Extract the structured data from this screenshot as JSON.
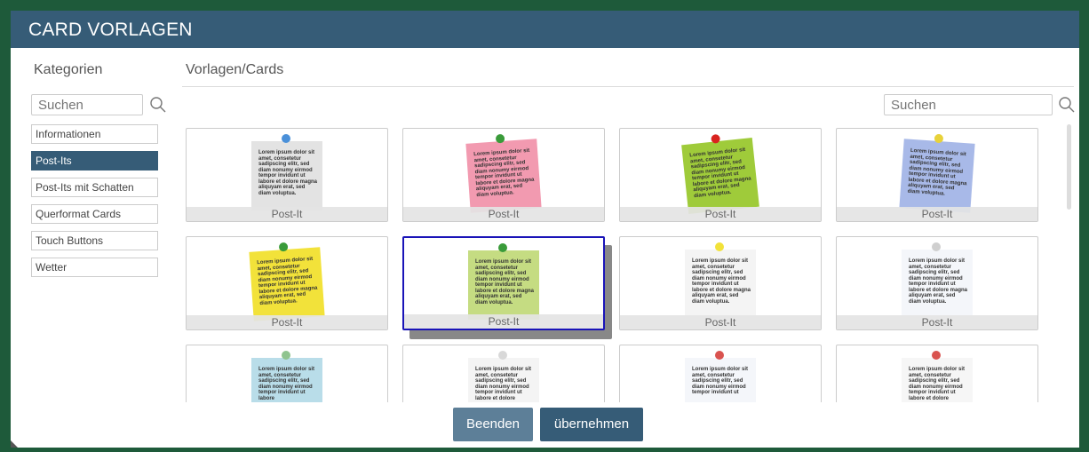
{
  "title": "CARD VORLAGEN",
  "categories": {
    "heading": "Kategorien",
    "search_placeholder": "Suchen",
    "items": [
      "Informationen",
      "Post-Its",
      "Post-Its mit Schatten",
      "Querformat Cards",
      "Touch Buttons",
      "Wetter"
    ],
    "active_index": 1
  },
  "templates": {
    "heading": "Vorlagen/Cards",
    "search_placeholder": "Suchen",
    "cards": [
      {
        "label": "Post-It",
        "color": "#e3e3e3",
        "pin": "#4a90d9",
        "text": "Lorem ipsum dolor sit amet, consetetur sadipscing elitr, sed diam nonumy eirmod tempor invidunt ut labore et dolore magna aliquyam erat, sed diam voluptua."
      },
      {
        "label": "Post-It",
        "color": "#f29ab0",
        "pin": "#3a9b3a",
        "text": "Lorem ipsum dolor sit amet, consetetur sadipscing elitr, sed diam nonumy eirmod tempor invidunt ut labore et dolore magna aliquyam erat, sed diam voluptua."
      },
      {
        "label": "Post-It",
        "color": "#9fcb3a",
        "pin": "#d9231f",
        "text": "Lorem ipsum dolor sit amet, consetetur sadipscing elitr, sed diam nonumy eirmod tempor invidunt ut labore et dolore magna aliquyam erat, sed diam voluptua."
      },
      {
        "label": "Post-It",
        "color": "#a8b9e8",
        "pin": "#e8d23a",
        "text": "Lorem ipsum dolor sit amet, consetetur sadipscing elitr, sed diam nonumy eirmod tempor invidunt ut labore et dolore magna aliquyam erat, sed diam voluptua."
      },
      {
        "label": "Post-It",
        "color": "#f2e23a",
        "pin": "#3a9b3a",
        "text": "Lorem ipsum dolor sit amet, consetetur sadipscing elitr, sed diam nonumy eirmod tempor invidunt ut labore et dolore magna aliquyam erat, sed diam voluptua."
      },
      {
        "label": "Post-It",
        "color": "#c5dc82",
        "pin": "#3a9b3a",
        "text": "Lorem ipsum dolor sit amet, consetetur sadipscing elitr, sed diam nonumy eirmod tempor invidunt ut labore et dolore magna aliquyam erat, sed diam voluptua."
      },
      {
        "label": "Post-It",
        "color": "#f4f4f4",
        "pin": "#f2e23a",
        "text": "Lorem ipsum dolor sit amet, consetetur sadipscing elitr, sed diam nonumy eirmod tempor invidunt ut labore et dolore magna aliquyam erat, sed diam voluptua."
      },
      {
        "label": "Post-It",
        "color": "#f4f6fa",
        "pin": "#cfcfcf",
        "text": "Lorem ipsum dolor sit amet, consetetur sadipscing elitr, sed diam nonumy eirmod tempor invidunt ut labore et dolore magna aliquyam erat, sed diam voluptua."
      },
      {
        "label": "",
        "color": "#b9dde9",
        "pin": "#8fc48f",
        "text": "Lorem ipsum dolor sit amet, consetetur sadipscing elitr, sed diam nonumy eirmod tempor invidunt ut labore"
      },
      {
        "label": "",
        "color": "#f4f4f4",
        "pin": "#d8d8d8",
        "text": "Lorem ipsum dolor sit amet, consetetur sadipscing elitr, sed diam nonumy eirmod tempor invidunt ut labore et dolore"
      },
      {
        "label": "",
        "color": "#f4f6fa",
        "pin": "#d9534f",
        "text": "Lorem ipsum dolor sit amet, consetetur sadipscing elitr, sed diam nonumy eirmod tempor invidunt ut"
      },
      {
        "label": "",
        "color": "#f6f6f6",
        "pin": "#d9534f",
        "text": "Lorem ipsum dolor sit amet, consetetur sadipscing elitr, sed diam nonumy eirmod tempor invidunt ut labore et dolore"
      }
    ],
    "selected_index": 5
  },
  "buttons": {
    "cancel": "Beenden",
    "apply": "übernehmen"
  },
  "colors": {
    "header": "#365c77",
    "active_category": "#365c77",
    "selected_border": "#1a14b8"
  }
}
